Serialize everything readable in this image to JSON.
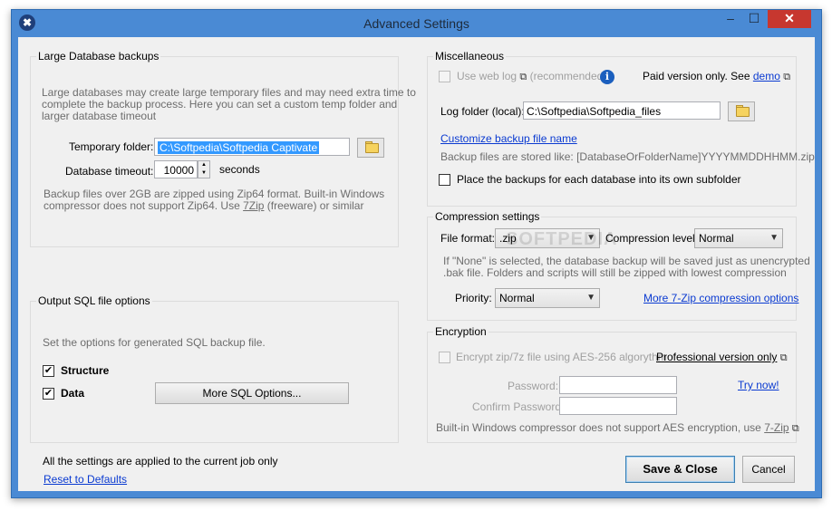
{
  "window": {
    "title": "Advanced Settings",
    "icons": {
      "app": "tools-icon",
      "minimize": "minimize-icon",
      "maximize": "maximize-icon",
      "close": "close-icon"
    }
  },
  "large_db": {
    "group_title": "Large Database backups",
    "description_1": "Large databases may create large temporary files and may need extra time to",
    "description_2": "complete the backup process. Here you can set a custom temp folder and",
    "description_3": "larger database timeout",
    "temp_folder_label": "Temporary folder:",
    "temp_folder_value": "C:\\Softpedia\\Softpedia Captivate",
    "timeout_label": "Database timeout:",
    "timeout_value": "10000",
    "timeout_unit": "seconds",
    "zip_note_1": "Backup files over 2GB are zipped using Zip64 format. Built-in Windows",
    "zip_note_2_prefix": "compressor does not support Zip64. Use ",
    "zip_note_2_link": "7Zip",
    "zip_note_2_suffix": " (freeware) or similar"
  },
  "sql_options": {
    "group_title": "Output SQL file options",
    "description": "Set the options for generated SQL backup file.",
    "structure_label": "Structure",
    "structure_checked": true,
    "data_label": "Data",
    "data_checked": true,
    "more_button": "More SQL Options..."
  },
  "footer": {
    "note": "All the settings are applied to the current job only",
    "reset_link": "Reset to Defaults",
    "save_button": "Save & Close",
    "cancel_button": "Cancel"
  },
  "misc": {
    "group_title": "Miscellaneous",
    "web_log_label": "Use web log",
    "web_log_recommended": "(recommended)",
    "paid_note": "Paid version only. See ",
    "demo_link": "demo",
    "log_folder_label": "Log folder (local):",
    "log_folder_value": "C:\\Softpedia\\Softpedia_files",
    "custom_name_link": "Customize backup file name",
    "stored_like": "Backup files are stored like: [DatabaseOrFolderName]YYYYMMDDHHMM.zip",
    "subfolder_label": "Place the backups for each database into its own subfolder",
    "subfolder_checked": false
  },
  "compression": {
    "group_title": "Compression settings",
    "format_label": "File format:",
    "format_value": ".zip",
    "level_label": "Compression level:",
    "level_value": "Normal",
    "note_1": "If \"None\" is selected, the database backup will be saved just as unencrypted",
    "note_2": ".bak file. Folders and scripts will still be zipped with lowest compression",
    "priority_label": "Priority:",
    "priority_value": "Normal",
    "more_link": "More 7-Zip compression options"
  },
  "encryption": {
    "group_title": "Encryption",
    "encrypt_label": "Encrypt zip/7z file using AES-256 algorythm",
    "pro_link": "Professional version only",
    "password_label": "Password:",
    "confirm_label": "Confirm Password:",
    "try_link": "Try now!",
    "note_prefix": "Built-in Windows compressor does not support AES encryption, use ",
    "note_link": "7-Zip"
  },
  "watermark": "SOFTPEDIA"
}
